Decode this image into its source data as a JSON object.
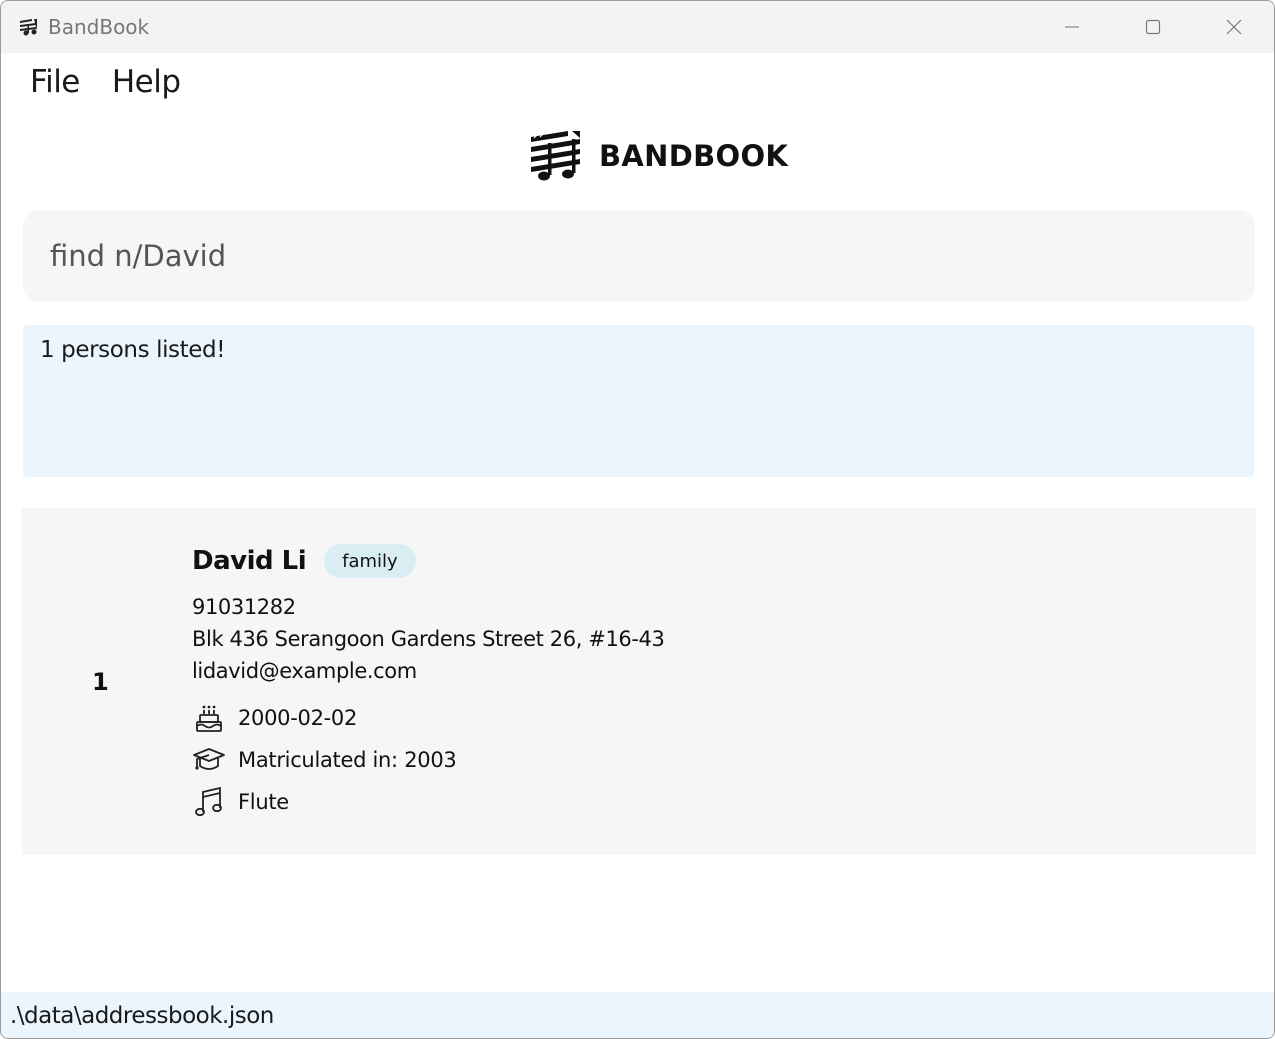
{
  "window": {
    "title": "BandBook",
    "icons": {
      "app": "bandbook-app-icon",
      "minimize": "minimize-icon",
      "maximize": "maximize-icon",
      "close": "close-icon"
    }
  },
  "menu": {
    "items": [
      {
        "label": "File"
      },
      {
        "label": "Help"
      }
    ]
  },
  "logo": {
    "text": "BANDBOOK",
    "icon": "music-staff-logo-icon"
  },
  "command": {
    "text": "find n/David"
  },
  "result": {
    "text": "1 persons listed!"
  },
  "persons": [
    {
      "index": "1",
      "name": "David Li",
      "tag": "family",
      "phone": "91031282",
      "address": "Blk 436 Serangoon Gardens Street 26, #16-43",
      "email": "lidavid@example.com",
      "birthday": "2000-02-02",
      "matriculation": "Matriculated in: 2003",
      "instrument": "Flute",
      "icons": {
        "birthday": "birthday-cake-icon",
        "matriculation": "graduation-cap-icon",
        "instrument": "music-note-icon"
      }
    }
  ],
  "status": {
    "path": ".\\data\\addressbook.json"
  },
  "colors": {
    "result_bg": "#eaf5fd",
    "card_bg": "#f6f6f6",
    "tag_bg": "#d9eef2",
    "command_bg": "#f6f6f6"
  }
}
